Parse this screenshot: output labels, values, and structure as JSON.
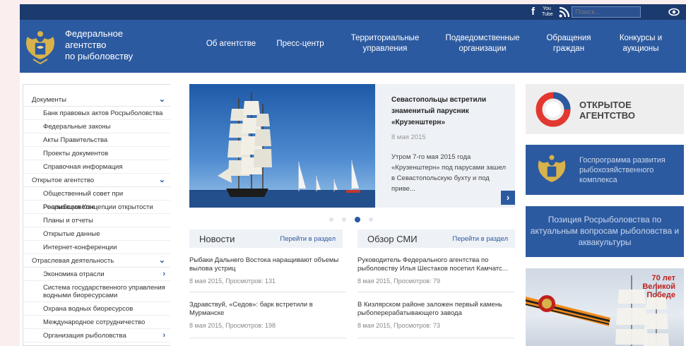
{
  "topbar": {
    "search_placeholder": "Поиск...",
    "icons": [
      "facebook-icon",
      "youtube-icon",
      "rss-icon",
      "eye-icon"
    ],
    "youtube_label": "You Tube",
    "facebook_glyph": "f"
  },
  "header": {
    "logo_lines": [
      "Федеральное",
      "агентство",
      "по рыболовству"
    ],
    "nav": [
      {
        "line1": "Об агентстве",
        "line2": ""
      },
      {
        "line1": "Пресс-центр",
        "line2": ""
      },
      {
        "line1": "Территориальные",
        "line2": "управления"
      },
      {
        "line1": "Подведомственные",
        "line2": "организации"
      },
      {
        "line1": "Обращения",
        "line2": "граждан"
      },
      {
        "line1": "Конкурсы и",
        "line2": "аукционы"
      }
    ]
  },
  "sidebar": {
    "items": [
      {
        "label": "Документы",
        "level": "top",
        "chevron": "⌄"
      },
      {
        "label": "Банк правовых актов Росрыболовства",
        "level": "sub"
      },
      {
        "label": "Федеральные законы",
        "level": "sub"
      },
      {
        "label": "Акты Правительства",
        "level": "sub"
      },
      {
        "label": "Проекты документов",
        "level": "sub"
      },
      {
        "label": "Справочная информация",
        "level": "sub"
      },
      {
        "label": "Открытое агентство",
        "level": "top",
        "chevron": "⌄"
      },
      {
        "label": "Общественный совет при Росрыболовстве",
        "level": "sub"
      },
      {
        "label": "Реализация Концепции открытости",
        "level": "sub"
      },
      {
        "label": "Планы и отчеты",
        "level": "sub"
      },
      {
        "label": "Открытые данные",
        "level": "sub"
      },
      {
        "label": "Интернет-конференции",
        "level": "sub"
      },
      {
        "label": "Отраслевая деятельность",
        "level": "top",
        "chevron": "⌄"
      },
      {
        "label": "Экономика отрасли",
        "level": "sub",
        "chevron": "›"
      },
      {
        "label": "Система государственного управления водными биоресурсами",
        "level": "sub2"
      },
      {
        "label": "Охрана водных биоресурсов",
        "level": "sub"
      },
      {
        "label": "Международное сотрудничество",
        "level": "sub"
      },
      {
        "label": "Организация рыболовства",
        "level": "sub",
        "chevron": "›"
      }
    ]
  },
  "slider": {
    "title": "Севастопольцы встретили знаменитый парусник «Крузенштерн»",
    "date": "8 мая 2015",
    "text": "Утром 7-го мая 2015 года «Крузенштерн» под парусами зашел в Севастопольскую бухту и под приве...",
    "next": "›",
    "slide_count": 4,
    "active_slide": 3
  },
  "news": {
    "title": "Новости",
    "link": "Перейти в раздел",
    "items": [
      {
        "head": "Рыбаки Дальнего Востока наращивают объемы вылова устриц",
        "meta": "8 мая 2015, Просмотров: 131"
      },
      {
        "head": "Здравствуй, «Седов»: барк встретили в Мурманске",
        "meta": "8 мая 2015, Просмотров: 198"
      }
    ]
  },
  "media": {
    "title": "Обзор СМИ",
    "link": "Перейти в раздел",
    "items": [
      {
        "head": "Руководитель Федерального агентства по рыболовству Илья Шестаков посетил Камчатс...",
        "meta": "8 мая 2015, Просмотров: 79"
      },
      {
        "head": "В Кизлярском районе заложен первый камень рыбоперерабатывающего завода",
        "meta": "8 мая 2015, Просмотров: 73"
      }
    ]
  },
  "right": {
    "open_agency": [
      "ОТКРЫТОЕ",
      "АГЕНТСТВО"
    ],
    "program": "Госпрограмма развития рыбохозяйственного комплекса",
    "position": "Позиция Росрыболовства по актуальным вопросам рыболовства и аквакультуры",
    "victory": [
      "70 лет",
      "Великой",
      "Победе"
    ]
  },
  "colors": {
    "topbar": "#1b3a6e",
    "header": "#2c5aa0",
    "accent": "#2c5aa0",
    "victory_red": "#c0211e"
  }
}
